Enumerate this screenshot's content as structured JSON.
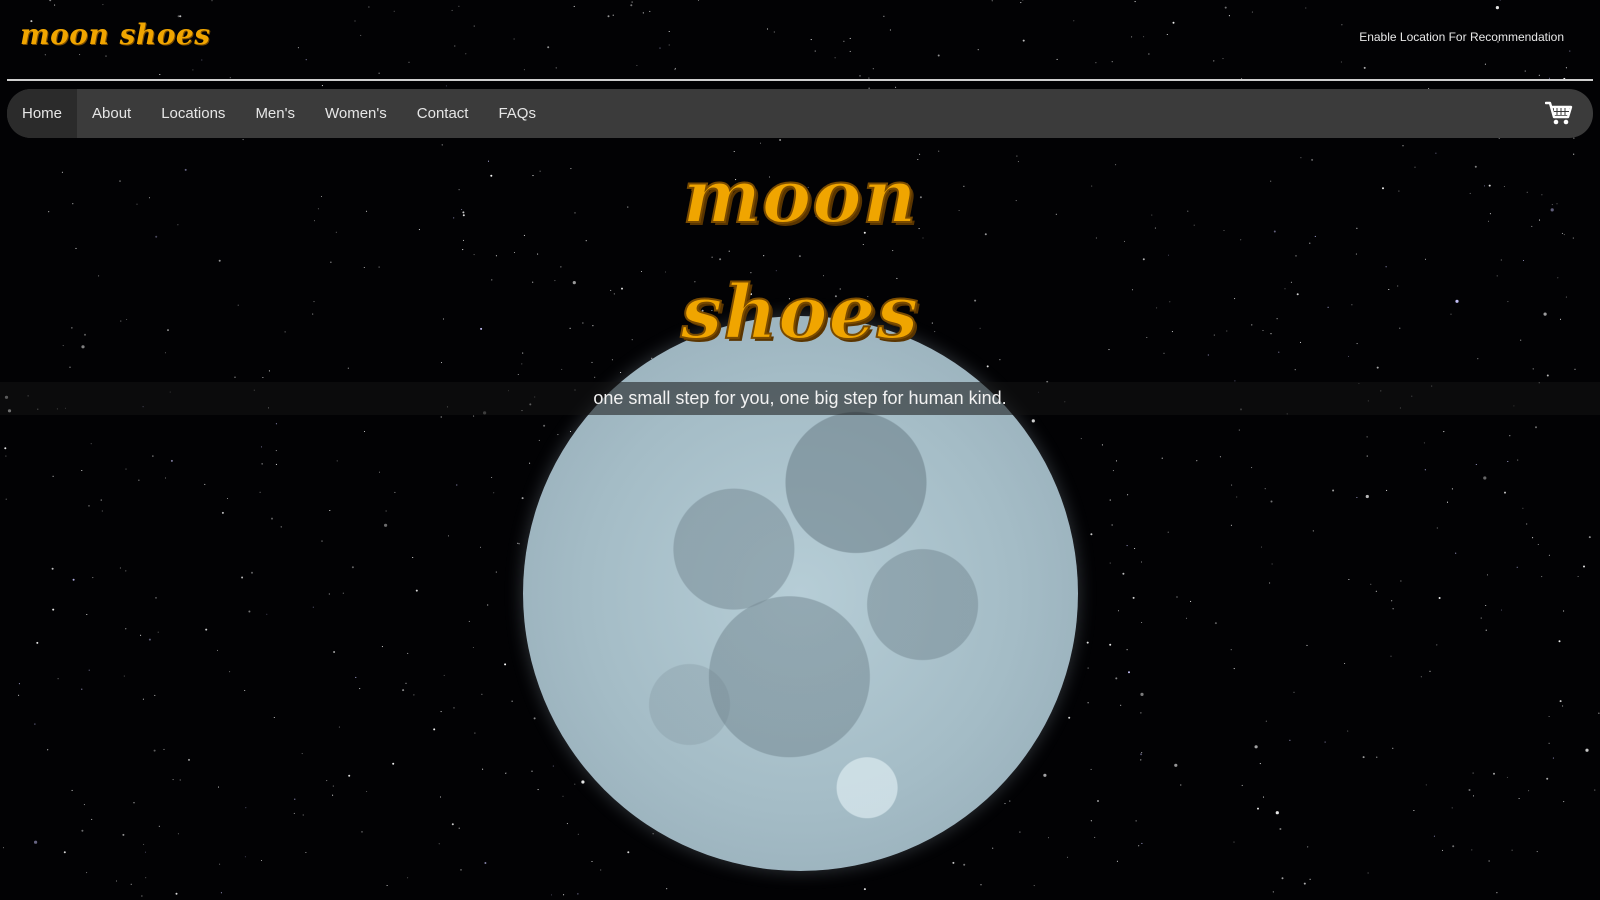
{
  "header": {
    "logo": "moon shoes",
    "location_link": "Enable Location For Recommendation"
  },
  "nav": {
    "items": [
      {
        "label": "Home",
        "active": true
      },
      {
        "label": "About",
        "active": false
      },
      {
        "label": "Locations",
        "active": false
      },
      {
        "label": "Men's",
        "active": false
      },
      {
        "label": "Women's",
        "active": false
      },
      {
        "label": "Contact",
        "active": false
      },
      {
        "label": "FAQs",
        "active": false
      }
    ],
    "cart_icon": "shopping-cart-icon"
  },
  "hero": {
    "title_line1": "moon",
    "title_line2": "shoes",
    "tagline": "one small step for you, one big step for human kind."
  },
  "colors": {
    "brand": "#f0a500",
    "nav_background": "#3b3b3b",
    "nav_active": "#2b2b2b",
    "page_background": "#020204"
  }
}
